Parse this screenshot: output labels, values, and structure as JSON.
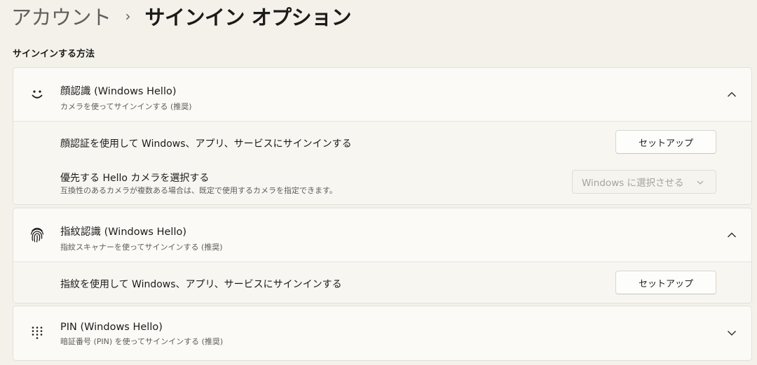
{
  "breadcrumb": {
    "parent": "アカウント",
    "separator": "›",
    "current": "サインイン オプション"
  },
  "section": {
    "title": "サインインする方法"
  },
  "face": {
    "icon": "smile-face-icon",
    "title": "顔認識 (Windows Hello)",
    "subtitle": "カメラを使ってサインインする (推奨)",
    "expanded": true,
    "setup_label": "顔認証を使用して Windows、アプリ、サービスにサインインする",
    "setup_button": "セットアップ",
    "camera_label": "優先する Hello カメラを選択する",
    "camera_sub": "互換性のあるカメラが複数ある場合は、既定で使用するカメラを指定できます。",
    "camera_select_value": "Windows に選択させる"
  },
  "fingerprint": {
    "icon": "fingerprint-icon",
    "title": "指紋認識 (Windows Hello)",
    "subtitle": "指紋スキャナーを使ってサインインする (推奨)",
    "expanded": true,
    "setup_label": "指紋を使用して Windows、アプリ、サービスにサインインする",
    "setup_button": "セットアップ"
  },
  "pin": {
    "icon": "pin-keypad-icon",
    "title": "PIN (Windows Hello)",
    "subtitle": "暗証番号 (PIN) を使ってサインインする (推奨)",
    "expanded": false
  }
}
